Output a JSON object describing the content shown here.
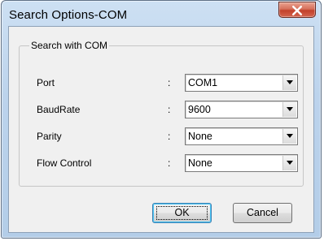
{
  "window": {
    "title": "Search Options-COM",
    "close_icon": "close-icon"
  },
  "group": {
    "legend": "Search with COM"
  },
  "fields": {
    "port": {
      "label": "Port",
      "value": "COM1"
    },
    "baudrate": {
      "label": "BaudRate",
      "value": "9600"
    },
    "parity": {
      "label": "Parity",
      "value": "None"
    },
    "flow_control": {
      "label": "Flow Control",
      "value": "None"
    },
    "separator": ":"
  },
  "buttons": {
    "ok_label": "OK",
    "cancel_label": "Cancel"
  },
  "colors": {
    "close_button": "#c7432f",
    "default_button_border": "#3c7fb1",
    "dialog_background": "#f0f0f0"
  }
}
